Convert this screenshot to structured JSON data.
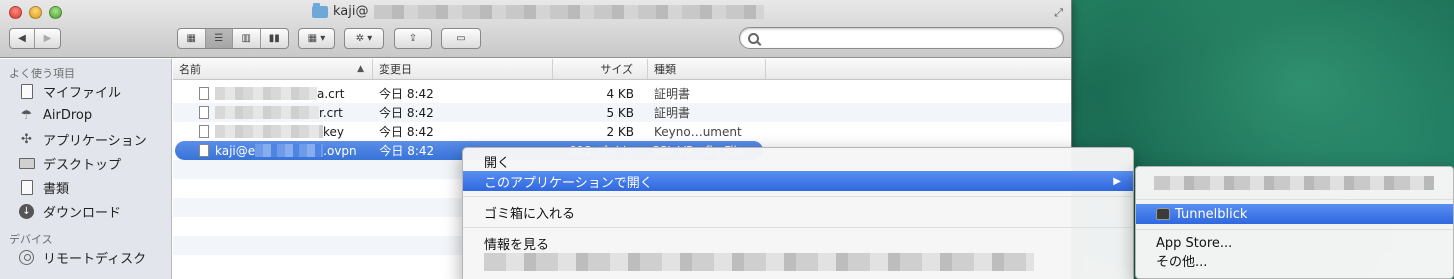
{
  "window": {
    "title": "kaji@"
  },
  "search": {
    "placeholder": ""
  },
  "sidebar": {
    "favorites_header": "よく使う項目",
    "favorites": [
      {
        "label": "マイファイル",
        "icon": "my-files-icon"
      },
      {
        "label": "AirDrop",
        "icon": "airdrop-icon"
      },
      {
        "label": "アプリケーション",
        "icon": "applications-icon"
      },
      {
        "label": "デスクトップ",
        "icon": "desktop-icon"
      },
      {
        "label": "書類",
        "icon": "documents-icon"
      },
      {
        "label": "ダウンロード",
        "icon": "downloads-icon"
      }
    ],
    "devices_header": "デバイス",
    "devices": [
      {
        "label": "リモートディスク",
        "icon": "remote-disc-icon"
      }
    ]
  },
  "columns": {
    "name": "名前",
    "date": "変更日",
    "size": "サイズ",
    "kind": "種類"
  },
  "files": [
    {
      "name_suffix": "a.crt",
      "date": "今日 8:42",
      "size": "4 KB",
      "kind": "証明書"
    },
    {
      "name_suffix": "r.crt",
      "date": "今日 8:42",
      "size": "5 KB",
      "kind": "証明書"
    },
    {
      "name_suffix": "key",
      "date": "今日 8:42",
      "size": "2 KB",
      "kind": "Keyno…ument"
    },
    {
      "name_prefix": "kaji@e",
      "name_suffix": ".ovpn",
      "date": "今日 8:42",
      "size": "812 バイト",
      "kind": "SSL VP…fig File"
    }
  ],
  "context_menu": {
    "open": "開く",
    "open_with": "このアプリケーションで開く",
    "move_to_trash": "ゴミ箱に入れる",
    "get_info": "情報を見る"
  },
  "submenu": {
    "tunnelblick": "Tunnelblick",
    "app_store": "App Store...",
    "other": "その他..."
  }
}
